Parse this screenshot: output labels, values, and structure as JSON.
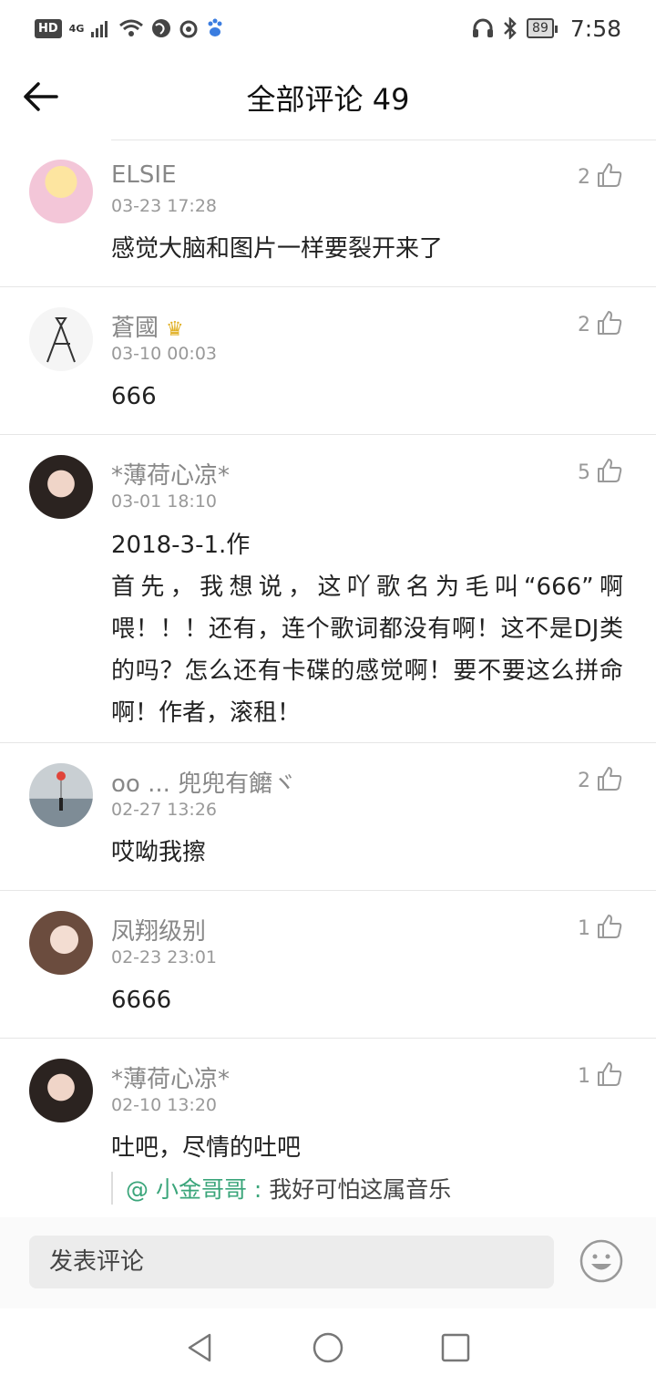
{
  "status_bar": {
    "hd": "HD",
    "network": "4G",
    "battery": "89",
    "time": "7:58"
  },
  "header": {
    "title": "全部评论 49"
  },
  "comments": [
    {
      "user": "ELSIE",
      "time": "03-23 17:28",
      "likes": "2",
      "text": "感觉大脑和图片一样要裂开来了",
      "avatar_color": "#f3c6d8"
    },
    {
      "user": "蒼國",
      "badge": "crown",
      "time": "03-10 00:03",
      "likes": "2",
      "text": "666",
      "avatar_color": "#f5f5f5"
    },
    {
      "user": "*薄荷心凉*",
      "time": "03-01 18:10",
      "likes": "5",
      "text": "2018-3-1.作\n首先，我想说，这吖歌名为毛叫“666”啊喂！！！还有，连个歌词都没有啊！这不是DJ类的吗？怎么还有卡碟的感觉啊！要不要这么拼命啊！作者，滚租！",
      "avatar_color": "#d9b8a8"
    },
    {
      "user": "oo ... 兜兜有饝ヾ",
      "time": "02-27 13:26",
      "likes": "2",
      "text": "哎呦我擦",
      "avatar_color": "#9aa6ae"
    },
    {
      "user": "凤翔级别",
      "time": "02-23 23:01",
      "likes": "1",
      "text": "6666",
      "avatar_color": "#c7a79b"
    },
    {
      "user": "*薄荷心凉*",
      "time": "02-10 13:20",
      "likes": "1",
      "text": "吐吧，尽情的吐吧",
      "reply_user": "@ 小金哥哥 :",
      "reply_text": "我好可怕这属音乐",
      "avatar_color": "#d9b8a8"
    }
  ],
  "input": {
    "placeholder": "发表评论"
  },
  "icons": {
    "back": "arrow-left-icon",
    "like": "thumbs-up-icon",
    "emoji": "smiley-icon"
  }
}
